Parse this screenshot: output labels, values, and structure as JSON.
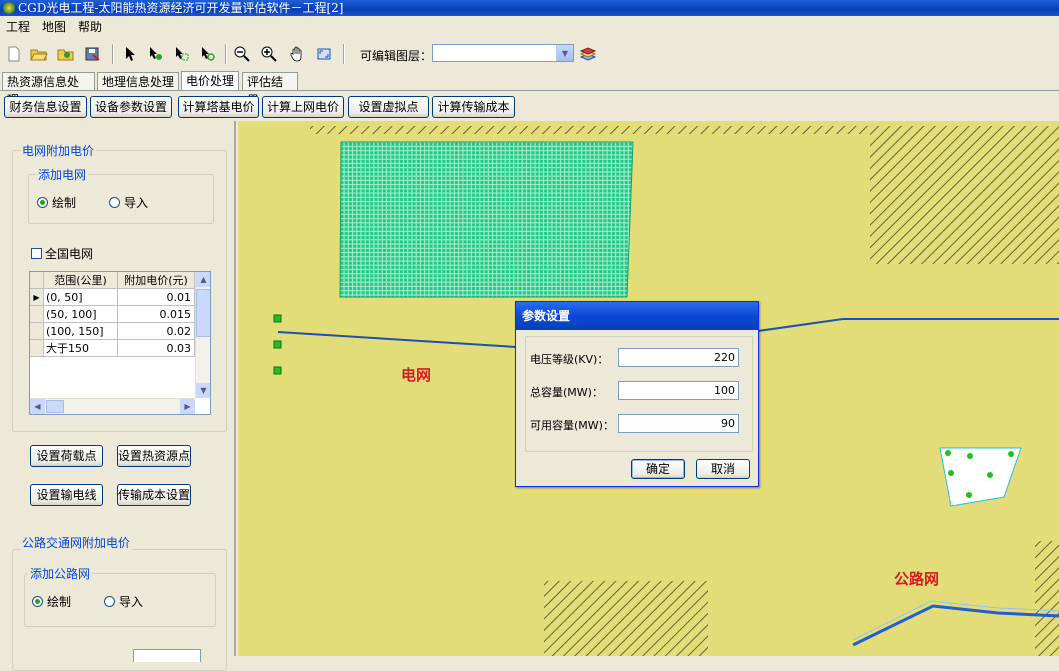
{
  "window": {
    "title": "CGD光电工程-太阳能热资源经济可开发量评估软件－工程[2]"
  },
  "menu": [
    "工程",
    "地图",
    "帮助"
  ],
  "toolbar": {
    "icons": [
      "new-file-icon",
      "open-folder-icon",
      "open-project-icon",
      "save-icon",
      "pointer-icon",
      "select-arrow-icon",
      "select-area-icon",
      "select-point-icon",
      "zoom-out-icon",
      "zoom-in-icon",
      "pan-hand-icon",
      "full-extent-icon",
      "layers-icon"
    ],
    "editable_layer_label": "可编辑图层：",
    "editable_layer_value": ""
  },
  "tabs": [
    {
      "label": "热资源信息处理",
      "active": false
    },
    {
      "label": "地理信息处理",
      "active": false
    },
    {
      "label": "电价处理",
      "active": true
    },
    {
      "label": "评估结果",
      "active": false
    }
  ],
  "actions": [
    "财务信息设置",
    "设备参数设置",
    "计算塔基电价",
    "计算上网电价",
    "设置虚拟点",
    "计算传输成本"
  ],
  "left": {
    "grid_section": "电网附加电价",
    "add_grid": "添加电网",
    "draw": "绘制",
    "import": "导入",
    "draw_selected": true,
    "national_grid": "全国电网",
    "national_checked": false,
    "table": {
      "headers": [
        "范围(公里)",
        "附加电价(元)"
      ],
      "rows": [
        [
          "(0, 50]",
          "0.01"
        ],
        [
          "(50, 100]",
          "0.015"
        ],
        [
          "(100, 150]",
          "0.02"
        ],
        [
          "大于150",
          "0.03"
        ]
      ]
    },
    "btn_load_point": "设置荷载点",
    "btn_heat_point": "设置热资源点",
    "btn_transmission_line": "设置输电线",
    "btn_transmission_cost": "传输成本设置",
    "road_section": "公路交通网附加电价",
    "add_road": "添加公路网",
    "road_draw": "绘制",
    "road_import": "导入",
    "road_draw_selected": true
  },
  "map": {
    "label_grid": "电网",
    "label_road": "公路网",
    "colors": {
      "background": "#e2dd78",
      "grid": "#6fa9a1",
      "hatch": "#6b6330",
      "green_area": "#21c98a",
      "line": "#1f4fb3"
    }
  },
  "dialog": {
    "title": "参数设置",
    "fields": [
      {
        "label": "电压等级(KV)：",
        "value": "220"
      },
      {
        "label": "总容量(MW)：",
        "value": "100"
      },
      {
        "label": "可用容量(MW)：",
        "value": "90"
      }
    ],
    "ok": "确定",
    "cancel": "取消"
  }
}
